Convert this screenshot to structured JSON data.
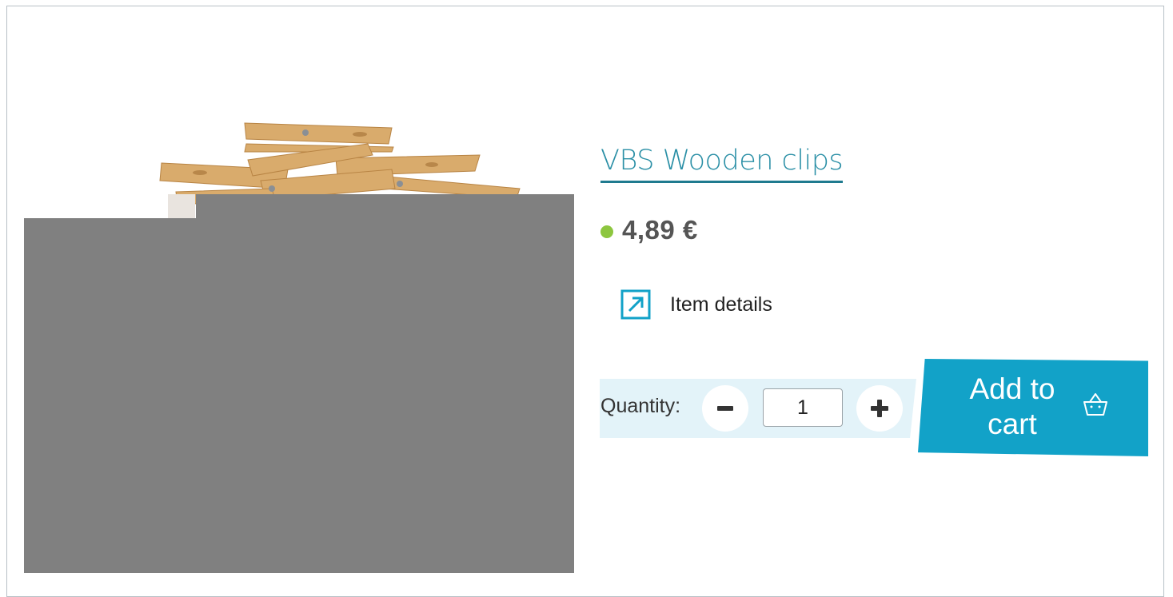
{
  "product": {
    "title": "VBS Wooden clips",
    "price": "4,89 €",
    "stock_status_color": "#8dc63f",
    "details_label": "Item details",
    "details_icon": "external-link-icon"
  },
  "purchase": {
    "quantity_label": "Quantity:",
    "quantity_value": "1",
    "decrement_icon": "minus-icon",
    "increment_icon": "plus-icon",
    "add_to_cart_label": "Add to\ncart",
    "cart_icon": "shopping-basket-icon"
  },
  "colors": {
    "link": "#2a8fa6",
    "accent": "#12a2c8",
    "panel": "#e3f3f9",
    "image_placeholder": "#808080"
  }
}
